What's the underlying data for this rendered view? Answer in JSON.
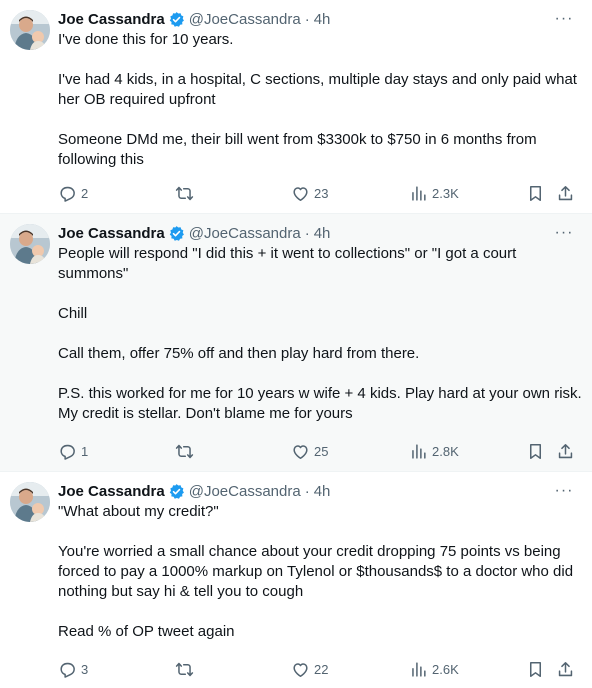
{
  "tweets": [
    {
      "author": {
        "name": "Joe Cassandra",
        "handle": "@JoeCassandra",
        "separator": "·",
        "time": "4h"
      },
      "lines": [
        "I've done this for 10 years.",
        "",
        "I've had 4 kids, in a hospital, C sections, multiple day stays and only paid what",
        "her OB required upfront",
        "",
        "Someone DMd me, their bill went from $3300k to $750 in 6 months from",
        "following this"
      ],
      "replies": "2",
      "retweets": "",
      "likes": "23",
      "views": "2.3K"
    },
    {
      "author": {
        "name": "Joe Cassandra",
        "handle": "@JoeCassandra",
        "separator": "·",
        "time": "4h"
      },
      "lines": [
        "People will respond \"I did this + it went to collections\" or \"I got a court",
        "summons\"",
        "",
        "Chill",
        "",
        "Call them, offer 75% off and then play hard from there.",
        "",
        "P.S. this worked for me for 10 years w wife + 4 kids. Play hard at your own risk.",
        "My credit is stellar. Don't blame me for yours"
      ],
      "replies": "1",
      "retweets": "",
      "likes": "25",
      "views": "2.8K"
    },
    {
      "author": {
        "name": "Joe Cassandra",
        "handle": "@JoeCassandra",
        "separator": "·",
        "time": "4h"
      },
      "lines": [
        "\"What about my credit?\"",
        "",
        "You're worried a small chance about your credit dropping 75 points vs being",
        "forced to pay a 1000% markup on Tylenol or $thousands$ to a doctor who did",
        "nothing but say hi & tell you to cough",
        "",
        "Read % of OP tweet again"
      ],
      "replies": "3",
      "retweets": "",
      "likes": "22",
      "views": "2.6K"
    }
  ],
  "icons": {
    "verified_color": "#1d9bf0",
    "more": "···"
  },
  "colors": {
    "text": "#0f1419",
    "secondary": "#536471",
    "highlight_bg": "#f7f9f9"
  }
}
